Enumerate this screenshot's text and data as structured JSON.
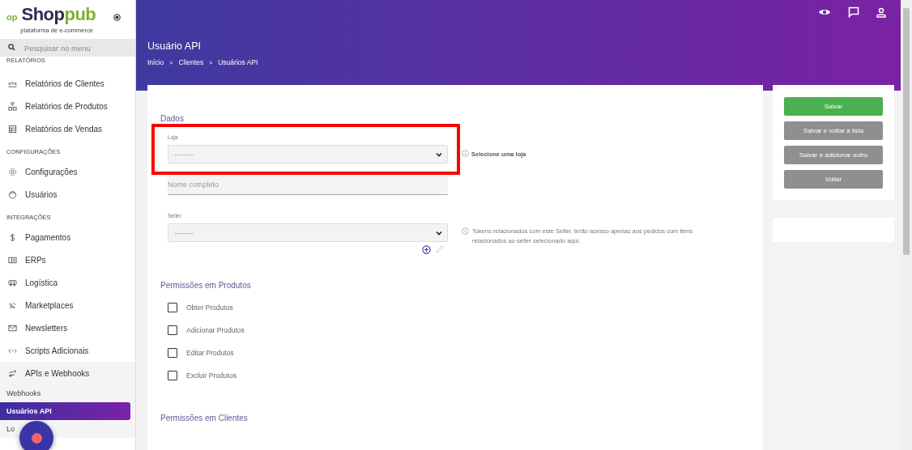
{
  "sidebar": {
    "logo": {
      "prefix": "op",
      "name_dark": "Shop",
      "name_green": "pub",
      "tagline": "plataforma de e-commerce"
    },
    "search": {
      "placeholder": "Pesquisar no menu"
    },
    "sections": [
      {
        "heading": "RELATÓRIOS",
        "items": [
          {
            "label": "Relatórios de Clientes"
          },
          {
            "label": "Relatórios de Produtos"
          },
          {
            "label": "Relatórios de Vendas"
          }
        ]
      },
      {
        "heading": "CONFIGURAÇÕES",
        "items": [
          {
            "label": "Configurações"
          },
          {
            "label": "Usuários"
          }
        ]
      },
      {
        "heading": "INTEGRAÇÕES",
        "items": [
          {
            "label": "Pagamentos"
          },
          {
            "label": "ERPs"
          },
          {
            "label": "Logística"
          },
          {
            "label": "Marketplaces"
          },
          {
            "label": "Newsletters"
          },
          {
            "label": "Scripts Adicionais"
          },
          {
            "label": "APIs e Webhooks",
            "expanded": true,
            "children": [
              {
                "label": "Webhooks",
                "selected": false
              },
              {
                "label": "Usuários API",
                "selected": true
              },
              {
                "label": "Lo",
                "selected": false
              }
            ]
          }
        ]
      }
    ]
  },
  "header": {
    "title": "Usuário API",
    "breadcrumb": [
      "Início",
      "Clientes",
      "Usuários API"
    ],
    "separator": ">"
  },
  "form": {
    "section": "Dados",
    "store": {
      "label": "Loja",
      "value": "---------",
      "hint": "Selecione uma loja",
      "highlighted": true
    },
    "name": {
      "placeholder": "Nome completo"
    },
    "seller": {
      "label": "Seller",
      "value": "---------",
      "hint": "Tokens relacionados com este Seller, terão acesso apenas aos pedidos com itens relacionados ao seller selecionado aqui."
    },
    "permission_groups": [
      {
        "title": "Permissões em Produtos",
        "items": [
          {
            "label": "Obter Produtos",
            "checked": false
          },
          {
            "label": "Adicionar Produtos",
            "checked": false
          },
          {
            "label": "Editar Produtos",
            "checked": false
          },
          {
            "label": "Excluir Produtos",
            "checked": false
          }
        ]
      },
      {
        "title": "Permissões em Clientes"
      }
    ]
  },
  "actions": [
    {
      "label": "Salvar",
      "kind": "primary"
    },
    {
      "label": "Salvar e voltar à lista",
      "kind": "secondary"
    },
    {
      "label": "Salvar e adicionar outro",
      "kind": "secondary"
    },
    {
      "label": "Voltar",
      "kind": "secondary"
    }
  ]
}
